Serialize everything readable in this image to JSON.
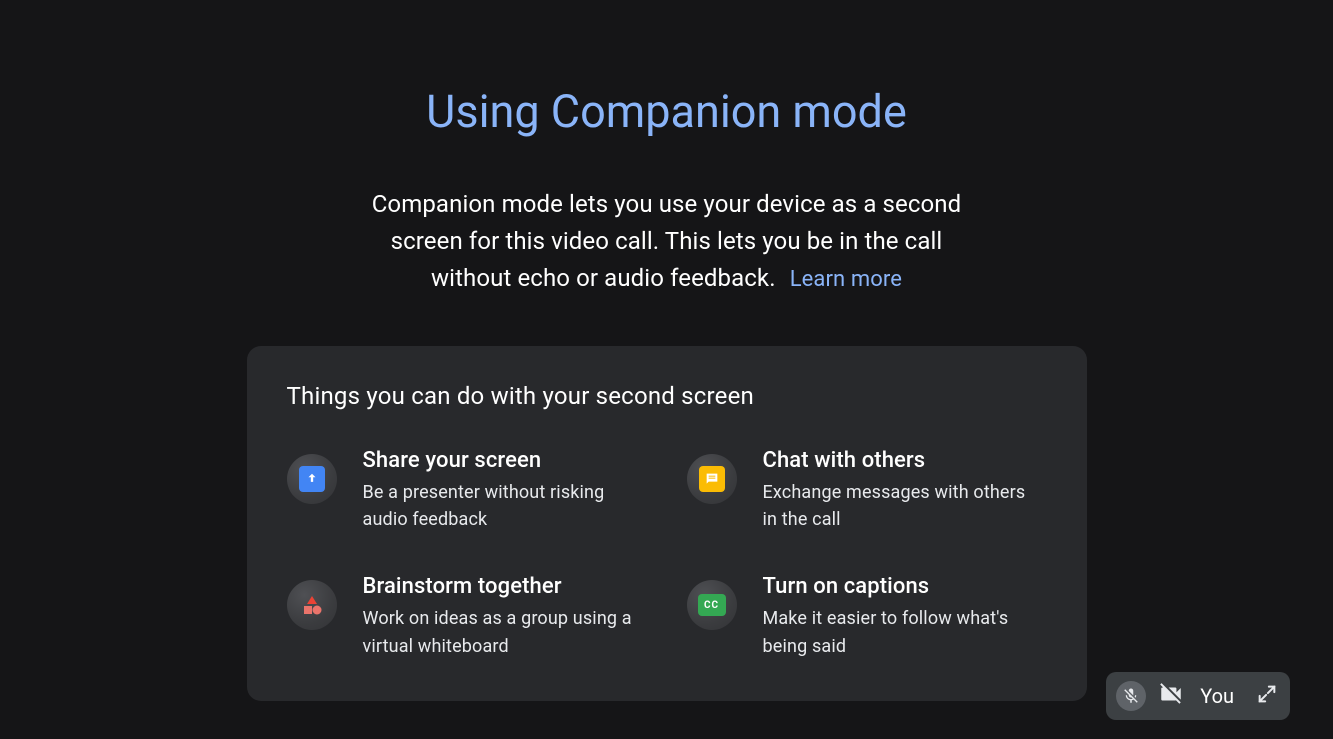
{
  "page": {
    "title": "Using Companion mode",
    "description": "Companion mode lets you use your device as a second screen for this video call. This lets you be in the call without echo or audio feedback.",
    "learn_more": "Learn more"
  },
  "features": {
    "heading": "Things you can do with your second screen",
    "items": [
      {
        "title": "Share your screen",
        "desc": "Be a presenter without risking audio feedback"
      },
      {
        "title": "Chat with others",
        "desc": "Exchange messages with others in the call"
      },
      {
        "title": "Brainstorm together",
        "desc": "Work on ideas as a group using a virtual whiteboard"
      },
      {
        "title": "Turn on captions",
        "desc": "Make it easier to follow what's being said"
      }
    ]
  },
  "self_tile": {
    "label": "You"
  }
}
